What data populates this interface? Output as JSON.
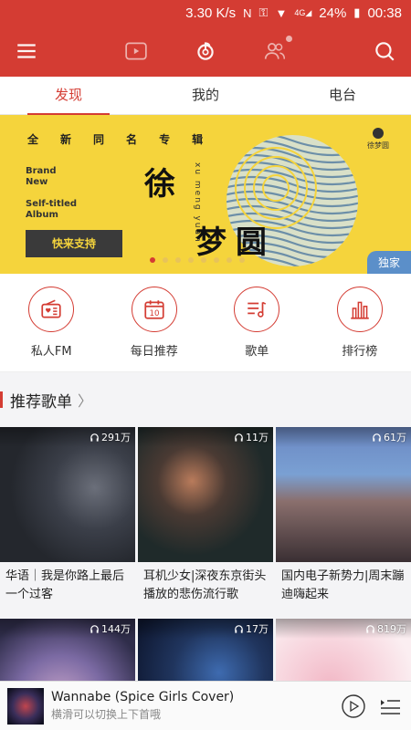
{
  "status": {
    "speed": "3.30 K/s",
    "battery": "24%",
    "time": "00:38",
    "network": "4G"
  },
  "tabs": [
    {
      "label": "发现",
      "active": true
    },
    {
      "label": "我的",
      "active": false
    },
    {
      "label": "电台",
      "active": false
    }
  ],
  "banner": {
    "headline_chars": [
      "全",
      "新",
      "同",
      "名",
      "专",
      "辑"
    ],
    "en_line1": "Brand",
    "en_line2": "New",
    "en_line3": "Self-titled",
    "en_line4": "Album",
    "button": "快来支持",
    "artist_char1": "徐",
    "artist_char2": "梦",
    "artist_char3": "圆",
    "pinyin": "xu meng yuan",
    "logo_text": "徐梦圆",
    "exclusive": "独家",
    "page_count": 8,
    "current_page": 1
  },
  "shortcuts": [
    {
      "label": "私人FM",
      "icon": "radio-icon"
    },
    {
      "label": "每日推荐",
      "icon": "calendar-icon",
      "day": "10"
    },
    {
      "label": "歌单",
      "icon": "playlist-icon"
    },
    {
      "label": "排行榜",
      "icon": "chart-icon"
    }
  ],
  "section": {
    "title": "推荐歌单",
    "chevron": "〉"
  },
  "playlists": [
    {
      "plays": "291万",
      "title": "华语｜我是你路上最后一个过客"
    },
    {
      "plays": "11万",
      "title": "耳机少女|深夜东京街头播放的悲伤流行歌"
    },
    {
      "plays": "61万",
      "title": "国内电子新势力|周末蹦迪嗨起来"
    },
    {
      "plays": "144万",
      "title": ""
    },
    {
      "plays": "17万",
      "title": ""
    },
    {
      "plays": "819万",
      "title": ""
    }
  ],
  "player": {
    "song": "Wannabe (Spice Girls Cover)",
    "hint": "横滑可以切换上下首哦"
  },
  "colors": {
    "primary": "#d43c33",
    "banner_bg": "#f5d43c",
    "exclusive_badge": "#5b8fc9"
  }
}
